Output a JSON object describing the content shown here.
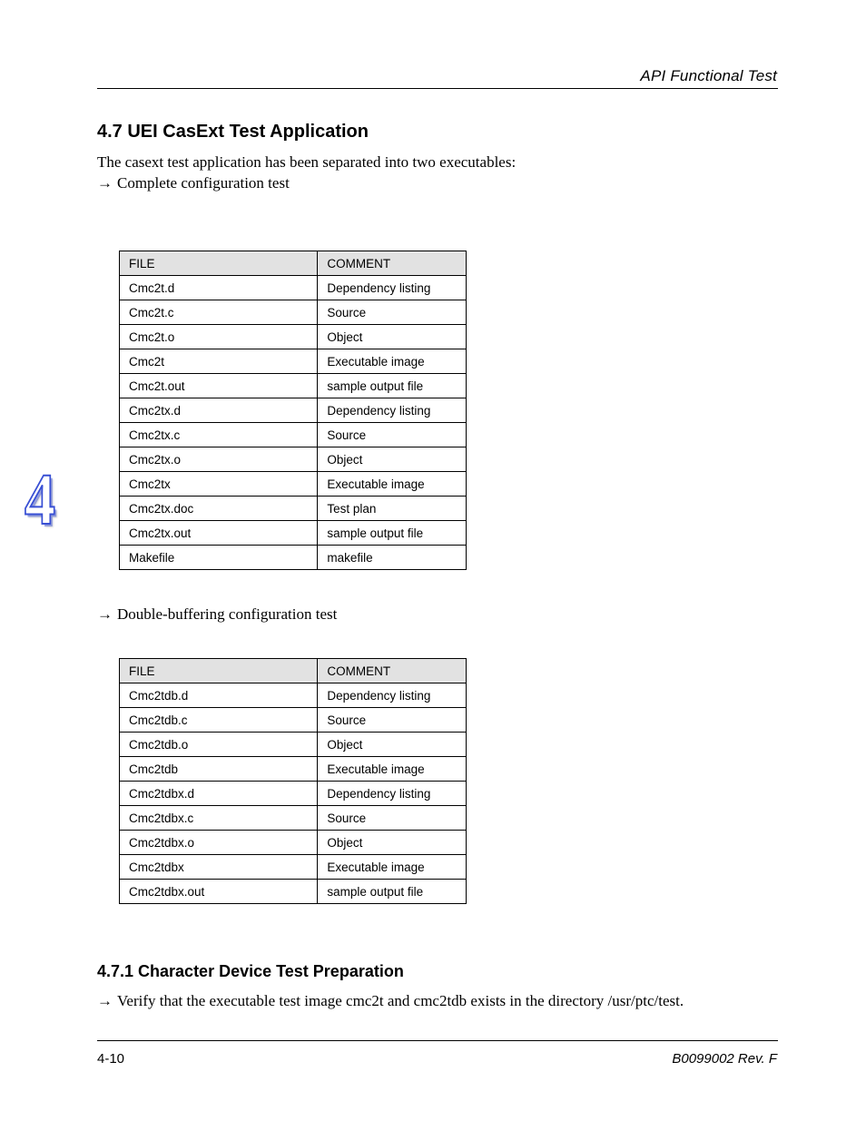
{
  "header": {
    "right_text": "API Functional Test"
  },
  "footer": {
    "left_text": "4-10",
    "right_text": "B0099002 Rev. F"
  },
  "section1": {
    "title": "4.7  UEI CasExt Test Application",
    "p1": "The casext test application has been separated into two executables:",
    "p2_arrow": "→",
    "p2": "Complete configuration test",
    "tbl_label": "",
    "table_headers": [
      "FILE",
      "COMMENT"
    ],
    "rows": [
      [
        "Cmc2t.d",
        "Dependency listing"
      ],
      [
        "Cmc2t.c",
        "Source"
      ],
      [
        "Cmc2t.o",
        "Object"
      ],
      [
        "Cmc2t",
        "Executable image"
      ],
      [
        "Cmc2t.out",
        "sample output file"
      ],
      [
        "Cmc2tx.d",
        "Dependency listing"
      ],
      [
        "Cmc2tx.c",
        "Source"
      ],
      [
        "Cmc2tx.o",
        "Object"
      ],
      [
        "Cmc2tx",
        "Executable image"
      ],
      [
        "Cmc2tx.doc",
        "Test plan"
      ],
      [
        "Cmc2tx.out",
        "sample output file"
      ],
      [
        "Makefile",
        "makefile"
      ]
    ],
    "p3_arrow": "→",
    "p3": "Double-buffering configuration test",
    "table2_headers": [
      "FILE",
      "COMMENT"
    ],
    "rows2": [
      [
        "Cmc2tdb.d",
        "Dependency listing"
      ],
      [
        "Cmc2tdb.c",
        "Source"
      ],
      [
        "Cmc2tdb.o",
        "Object"
      ],
      [
        "Cmc2tdb",
        "Executable image"
      ],
      [
        "Cmc2tdbx.d",
        "Dependency listing"
      ],
      [
        "Cmc2tdbx.c",
        "Source"
      ],
      [
        "Cmc2tdbx.o",
        "Object"
      ],
      [
        "Cmc2tdbx",
        "Executable image"
      ],
      [
        "Cmc2tdbx.out",
        "sample output file"
      ]
    ]
  },
  "section2": {
    "title": "4.7.1  Character Device Test Preparation",
    "p_arrow": "→",
    "p": "Verify that the executable test image cmc2t and cmc2tdb exists in the directory /usr/ptc/test."
  }
}
